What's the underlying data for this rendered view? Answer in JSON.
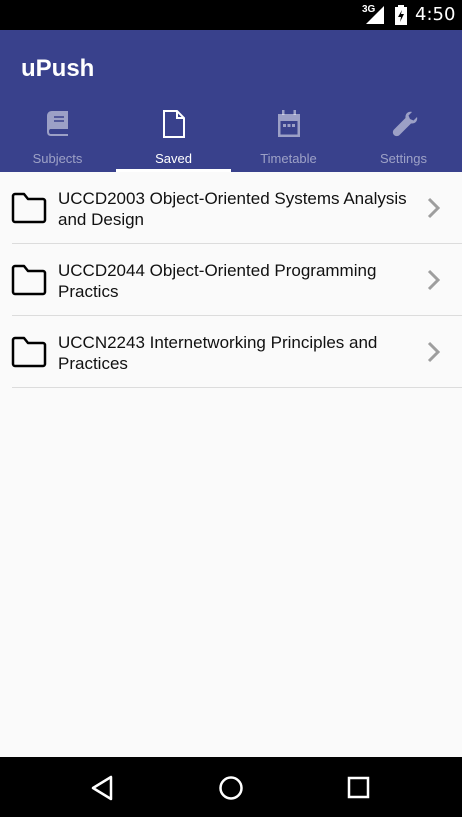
{
  "status_bar": {
    "network": "3G",
    "time": "4:50",
    "icons": [
      "signal-icon",
      "battery-icon"
    ]
  },
  "app": {
    "title": "uPush",
    "accent": "#39418c"
  },
  "tabs": [
    {
      "label": "Subjects",
      "icon": "book-icon",
      "active": false
    },
    {
      "label": "Saved",
      "icon": "document-icon",
      "active": true
    },
    {
      "label": "Timetable",
      "icon": "calendar-icon",
      "active": false
    },
    {
      "label": "Settings",
      "icon": "wrench-icon",
      "active": false
    }
  ],
  "saved_items": [
    {
      "text": "UCCD2003 Object-Oriented Systems Analysis and Design",
      "icon": "folder-icon"
    },
    {
      "text": "UCCD2044 Object-Oriented Programming Practics",
      "icon": "folder-icon"
    },
    {
      "text": "UCCN2243 Internetworking Principles and Practices",
      "icon": "folder-icon"
    }
  ],
  "nav_bar": {
    "icons": [
      "back-icon",
      "home-icon",
      "recents-icon"
    ]
  }
}
